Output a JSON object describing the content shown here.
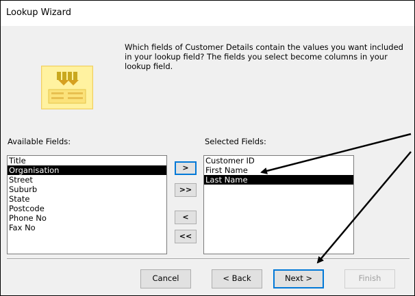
{
  "window": {
    "title": "Lookup Wizard"
  },
  "prompt": "Which fields of Customer Details contain the values you want included in your lookup field? The fields you select become columns in your lookup field.",
  "available": {
    "label": "Available Fields:",
    "items": [
      "Title",
      "Organisation",
      "Street",
      "Suburb",
      "State",
      "Postcode",
      "Phone No",
      "Fax No"
    ],
    "selected_index": 1
  },
  "selected": {
    "label": "Selected Fields:",
    "items": [
      "Customer ID",
      "First Name",
      "Last Name"
    ],
    "selected_index": 2
  },
  "move_buttons": {
    "add_one": ">",
    "add_all": ">>",
    "remove_one": "<",
    "remove_all": "<<"
  },
  "footer": {
    "cancel": "Cancel",
    "back": "< Back",
    "next": "Next >",
    "finish": "Finish"
  },
  "icon": "lookup-wizard-icon",
  "colors": {
    "arrow": "#000000",
    "selection": "#000000",
    "focus_border": "#0078d7"
  }
}
